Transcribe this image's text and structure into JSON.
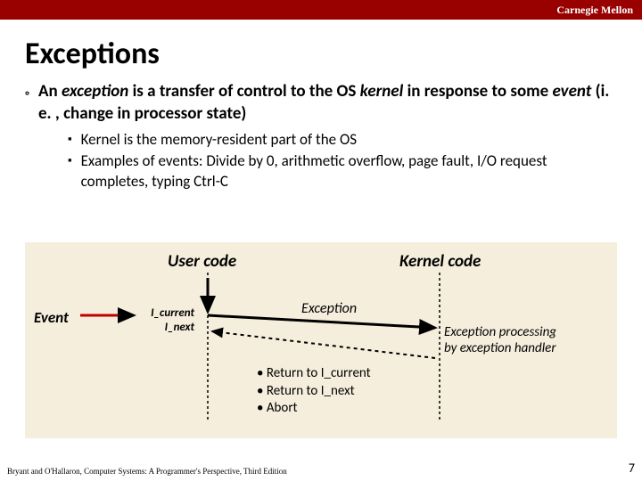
{
  "header": {
    "org": "Carnegie Mellon"
  },
  "title": "Exceptions",
  "main_bullet": {
    "pre": "An ",
    "em1": "exception",
    "mid": " is a transfer of control to the OS ",
    "em2": "kernel",
    "mid2": " in response to some ",
    "em3": "event",
    "post": "  (i. e. , change in processor state)"
  },
  "sub_bullets": [
    "Kernel is the memory-resident part of the OS",
    "Examples of events: Divide by 0, arithmetic overflow, page fault, I/O request completes, typing Ctrl-C"
  ],
  "diagram": {
    "user_code": "User code",
    "kernel_code": "Kernel code",
    "event": "Event",
    "i_current": "I_current",
    "i_next": "I_next",
    "exception": "Exception",
    "processing_l1": "Exception processing",
    "processing_l2": "by exception handler",
    "return_items": [
      "• Return to I_current",
      "• Return to I_next",
      "• Abort"
    ]
  },
  "footer": {
    "left": "Bryant and O'Hallaron, Computer Systems: A Programmer's Perspective, Third Edition",
    "page": "7"
  }
}
